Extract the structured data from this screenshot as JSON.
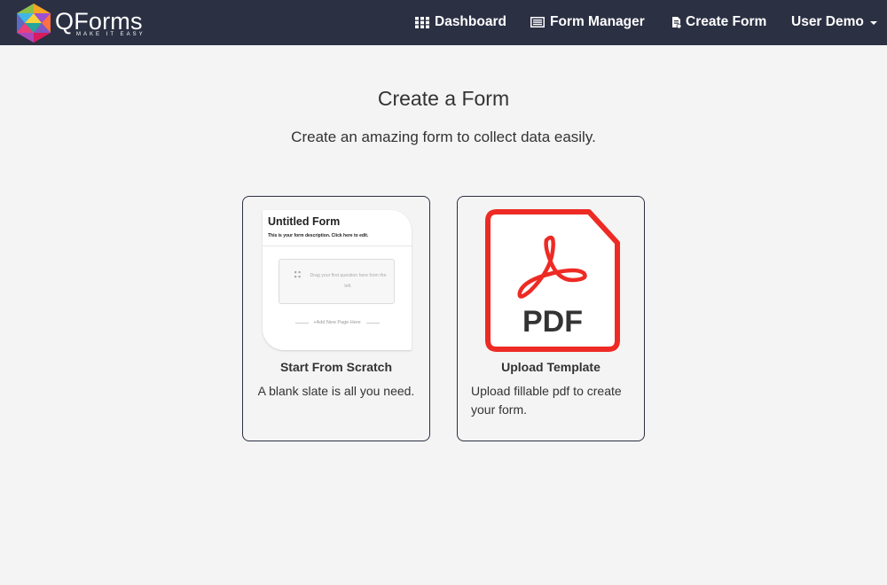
{
  "app": {
    "name": "QForms",
    "tagline": "MAKE IT EASY"
  },
  "nav": {
    "items": [
      {
        "label": "Dashboard",
        "icon": "grid-icon"
      },
      {
        "label": "Form Manager",
        "icon": "list-icon"
      },
      {
        "label": "Create Form",
        "icon": "form-add-icon"
      }
    ],
    "user_label": "User Demo"
  },
  "main": {
    "title": "Create a Form",
    "subtitle": "Create an amazing form to collect data easily."
  },
  "cards": [
    {
      "title": "Start From Scratch",
      "description": "A blank slate is all you need.",
      "preview": {
        "form_title": "Untitled Form",
        "form_description": "This is your form description. Click here to edit.",
        "drop_text": "Drag your first question here from the left.",
        "add_page": "+Add New Page Here"
      }
    },
    {
      "title": "Upload Template",
      "description": "Upload fillable pdf to create your form.",
      "icon_label": "PDF"
    }
  ],
  "colors": {
    "navbar": "#2b3043",
    "background": "#f4f4f4",
    "pdf_red": "#ee2a24"
  }
}
